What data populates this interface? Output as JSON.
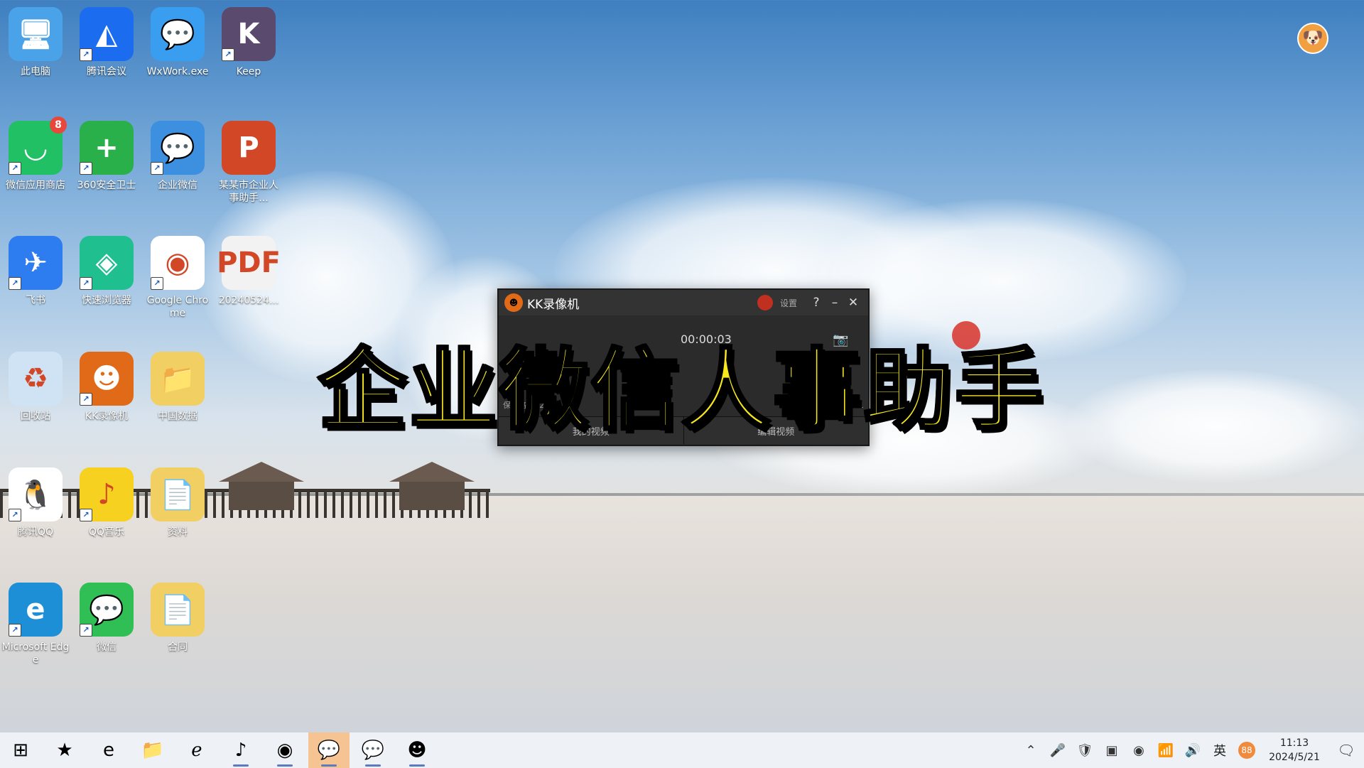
{
  "desktop": {
    "icons": [
      {
        "label": "此电脑",
        "icon": "computer-icon",
        "color": "#4aa3e8",
        "glyph": "🖥",
        "shortcut": false
      },
      {
        "label": "腾讯会议",
        "icon": "tencent-meeting-icon",
        "color": "#1c6cf0",
        "glyph": "◭",
        "shortcut": true
      },
      {
        "label": "WxWork.exe",
        "icon": "wxwork-exe-icon",
        "color": "#3a9ef0",
        "glyph": "💬",
        "shortcut": false
      },
      {
        "label": "Keep",
        "icon": "keep-icon",
        "color": "#5a4a6e",
        "glyph": "K",
        "shortcut": true
      },
      {
        "label": "微信应用商店",
        "icon": "wechat-store-icon",
        "color": "#22c064",
        "glyph": "◡",
        "shortcut": true,
        "badge": "8"
      },
      {
        "label": "360安全卫士",
        "icon": "360-security-icon",
        "color": "#2ab04a",
        "glyph": "+",
        "shortcut": true
      },
      {
        "label": "企业微信",
        "icon": "wecom-icon",
        "color": "#3d8fe0",
        "glyph": "💬",
        "shortcut": true
      },
      {
        "label": "某某市企业人事助手...",
        "icon": "powerpoint-file-icon",
        "color": "#d24726",
        "glyph": "P",
        "shortcut": false
      },
      {
        "label": "飞书",
        "icon": "feishu-icon",
        "color": "#2d7cf0",
        "glyph": "✈",
        "shortcut": true
      },
      {
        "label": "快速浏览器",
        "icon": "green-browser-icon",
        "color": "#1fbf8f",
        "glyph": "◈",
        "shortcut": true
      },
      {
        "label": "Google Chrome",
        "icon": "chrome-icon",
        "color": "#ffffff",
        "glyph": "◉",
        "shortcut": true
      },
      {
        "label": "20240524...",
        "icon": "pdf-file-icon",
        "color": "#f2f2f2",
        "glyph": "PDF",
        "shortcut": false
      },
      {
        "label": "回收站",
        "icon": "recycle-bin-icon",
        "color": "#cfe3f4",
        "glyph": "♻",
        "shortcut": false
      },
      {
        "label": "KK录像机",
        "icon": "kk-recorder-icon",
        "color": "#e06a18",
        "glyph": "☻",
        "shortcut": true
      },
      {
        "label": "中国数据",
        "icon": "folder-icon",
        "color": "#f2cf63",
        "glyph": "📁",
        "shortcut": false
      },
      {
        "label": "腾讯QQ",
        "icon": "qq-icon",
        "color": "#ffffff",
        "glyph": "🐧",
        "shortcut": true
      },
      {
        "label": "QQ音乐",
        "icon": "qq-music-icon",
        "color": "#f6d11f",
        "glyph": "♪",
        "shortcut": true
      },
      {
        "label": "资料",
        "icon": "document-folder-icon",
        "color": "#f2cf63",
        "glyph": "📄",
        "shortcut": false
      },
      {
        "label": "Microsoft Edge",
        "icon": "edge-icon",
        "color": "#1d8fd6",
        "glyph": "e",
        "shortcut": true
      },
      {
        "label": "微信",
        "icon": "wechat-icon",
        "color": "#2fbf55",
        "glyph": "💬",
        "shortcut": true
      },
      {
        "label": "合同",
        "icon": "document-folder-icon",
        "color": "#f2cf63",
        "glyph": "📄",
        "shortcut": false
      }
    ]
  },
  "kk_window": {
    "title": "KK录像机",
    "settings_label": "设置",
    "help_label": "?",
    "minimize_label": "–",
    "close_label": "✕",
    "timer": "00:00:03",
    "save_path_label": "保存路径: 2024...",
    "version_label": "版本: 2.9.5.1",
    "footer_buttons": [
      "我的视频",
      "编辑视频"
    ]
  },
  "caption": {
    "text": "企业微信人事助手"
  },
  "taskbar": {
    "apps": [
      {
        "icon": "windows-start-icon",
        "glyph": "⊞",
        "active": false,
        "running": false
      },
      {
        "icon": "star-app-icon",
        "glyph": "★",
        "active": false,
        "running": false
      },
      {
        "icon": "edge-icon",
        "glyph": "e",
        "active": false,
        "running": false
      },
      {
        "icon": "file-explorer-icon",
        "glyph": "📁",
        "active": false,
        "running": false
      },
      {
        "icon": "ie-browser-icon",
        "glyph": "ℯ",
        "active": false,
        "running": false
      },
      {
        "icon": "qq-music-icon",
        "glyph": "♪",
        "active": false,
        "running": true
      },
      {
        "icon": "chrome-icon",
        "glyph": "◉",
        "active": false,
        "running": true
      },
      {
        "icon": "wechat-icon",
        "glyph": "💬",
        "active": true,
        "running": true
      },
      {
        "icon": "wecom-icon",
        "glyph": "💬",
        "active": false,
        "running": true
      },
      {
        "icon": "kk-recorder-icon",
        "glyph": "☻",
        "active": false,
        "running": true
      }
    ],
    "tray_lang": "英",
    "tray_badge": "88",
    "time": "11:13",
    "date": "2024/5/21"
  },
  "colors": {
    "caption_fill": "#f7e81c",
    "caption_stroke": "#000000",
    "kk_accent": "#e06a18",
    "taskbar_active": "#f5c492"
  }
}
